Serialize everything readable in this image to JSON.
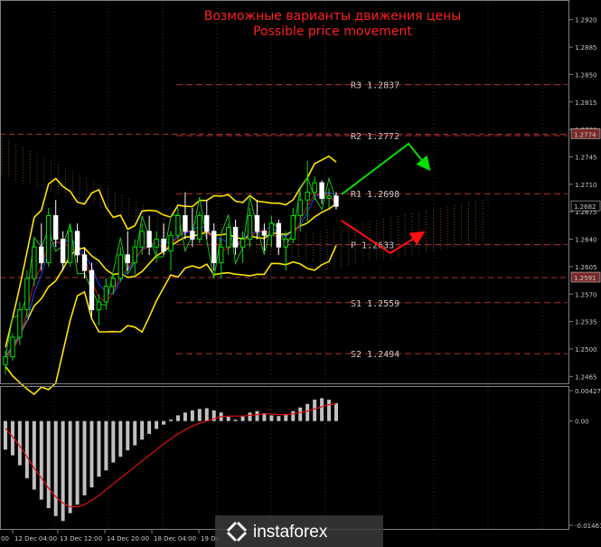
{
  "chart_data": {
    "type": "candlestick",
    "title_ru": "Возможные варианты движения цены",
    "title_en": "Possible price movement",
    "brand": "instaforex",
    "price_ticks": [
      "1.2920",
      "1.2885",
      "1.2850",
      "1.2815",
      "1.2780",
      "1.2745",
      "1.2710",
      "1.2675",
      "1.2640",
      "1.2605",
      "1.2570",
      "1.2535",
      "1.2500",
      "1.2465"
    ],
    "price_tick_values": [
      1.292,
      1.2885,
      1.285,
      1.2815,
      1.278,
      1.2745,
      1.271,
      1.2675,
      1.264,
      1.2605,
      1.257,
      1.2535,
      1.25,
      1.2465
    ],
    "price_range": [
      1.2455,
      1.2945
    ],
    "time_labels": [
      "12 Dec 04:00",
      "13 Dec 12:00",
      "14 Dec 20:00",
      "18 Dec 04:00",
      "19 De"
    ],
    "first_time_label": "00",
    "levels": [
      {
        "name": "R3",
        "text": "R3 1.2837",
        "value": 1.2837
      },
      {
        "name": "R2",
        "text": "R2 1.2772",
        "value": 1.2772
      },
      {
        "name": "R1",
        "text": "R1 1.2698",
        "value": 1.2698
      },
      {
        "name": "P",
        "text": "P 1.2633",
        "value": 1.2633
      },
      {
        "name": "S1",
        "text": "S1 1.2559",
        "value": 1.2559
      },
      {
        "name": "S2",
        "text": "S2 1.2494",
        "value": 1.2494
      }
    ],
    "price_tags": [
      {
        "text": "1.2774",
        "value": 1.2774,
        "bg": "#7a2a2a"
      },
      {
        "text": "1.2682",
        "value": 1.2682,
        "bg": "#000000"
      },
      {
        "text": "1.2591",
        "value": 1.2591,
        "bg": "#7a2a2a"
      }
    ],
    "candles": [
      [
        1.248,
        1.2498,
        1.2468,
        1.249
      ],
      [
        1.249,
        1.252,
        1.2485,
        1.2515
      ],
      [
        1.2515,
        1.256,
        1.2505,
        1.255
      ],
      [
        1.255,
        1.26,
        1.254,
        1.259
      ],
      [
        1.259,
        1.264,
        1.258,
        1.263
      ],
      [
        1.263,
        1.266,
        1.26,
        1.261
      ],
      [
        1.261,
        1.268,
        1.2605,
        1.267
      ],
      [
        1.267,
        1.269,
        1.263,
        1.264
      ],
      [
        1.264,
        1.265,
        1.26,
        1.261
      ],
      [
        1.261,
        1.266,
        1.2605,
        1.265
      ],
      [
        1.265,
        1.266,
        1.261,
        1.262
      ],
      [
        1.262,
        1.263,
        1.259,
        1.26
      ],
      [
        1.26,
        1.261,
        1.254,
        1.255
      ],
      [
        1.255,
        1.257,
        1.253,
        1.256
      ],
      [
        1.256,
        1.259,
        1.255,
        1.258
      ],
      [
        1.258,
        1.2595,
        1.257,
        1.259
      ],
      [
        1.259,
        1.263,
        1.2585,
        1.262
      ],
      [
        1.262,
        1.265,
        1.26,
        1.261
      ],
      [
        1.261,
        1.264,
        1.2595,
        1.263
      ],
      [
        1.263,
        1.266,
        1.262,
        1.265
      ],
      [
        1.265,
        1.267,
        1.262,
        1.263
      ],
      [
        1.263,
        1.265,
        1.261,
        1.264
      ],
      [
        1.264,
        1.266,
        1.262,
        1.2625
      ],
      [
        1.2625,
        1.265,
        1.26,
        1.2645
      ],
      [
        1.2645,
        1.268,
        1.264,
        1.267
      ],
      [
        1.267,
        1.27,
        1.264,
        1.265
      ],
      [
        1.265,
        1.268,
        1.263,
        1.264
      ],
      [
        1.264,
        1.2675,
        1.2635,
        1.267
      ],
      [
        1.267,
        1.269,
        1.264,
        1.265
      ],
      [
        1.265,
        1.266,
        1.26,
        1.261
      ],
      [
        1.261,
        1.264,
        1.259,
        1.263
      ],
      [
        1.263,
        1.266,
        1.262,
        1.2655
      ],
      [
        1.2655,
        1.2665,
        1.262,
        1.263
      ],
      [
        1.263,
        1.265,
        1.261,
        1.264
      ],
      [
        1.264,
        1.268,
        1.263,
        1.267
      ],
      [
        1.267,
        1.269,
        1.264,
        1.265
      ],
      [
        1.265,
        1.266,
        1.2625,
        1.2645
      ],
      [
        1.2645,
        1.267,
        1.263,
        1.266
      ],
      [
        1.266,
        1.2665,
        1.262,
        1.263
      ],
      [
        1.263,
        1.265,
        1.26,
        1.264
      ],
      [
        1.264,
        1.268,
        1.2635,
        1.267
      ],
      [
        1.267,
        1.27,
        1.265,
        1.269
      ],
      [
        1.269,
        1.274,
        1.266,
        1.27
      ],
      [
        1.27,
        1.272,
        1.269,
        1.2712
      ],
      [
        1.2712,
        1.2715,
        1.2685,
        1.2692
      ],
      [
        1.2692,
        1.2705,
        1.268,
        1.2695
      ],
      [
        1.2695,
        1.27,
        1.2678,
        1.2682
      ]
    ],
    "macd_range": [
      -0.0146,
      0.00427
    ],
    "macd_ticks": [
      {
        "text": "0.00427",
        "value": 0.00427
      },
      {
        "text": "0.00",
        "value": 0.0
      },
      {
        "text": "-0.01461",
        "value": -0.0146
      }
    ],
    "macd_hist": [
      -0.004,
      -0.0048,
      -0.0062,
      -0.008,
      -0.0096,
      -0.011,
      -0.0122,
      -0.0133,
      -0.014,
      -0.0129,
      -0.0117,
      -0.0104,
      -0.0093,
      -0.0078,
      -0.0069,
      -0.0058,
      -0.005,
      -0.0041,
      -0.0034,
      -0.0026,
      -0.0018,
      -0.0011,
      -0.0005,
      0.0002,
      0.0008,
      0.0012,
      0.0015,
      0.0017,
      0.0018,
      0.0015,
      0.0012,
      0.0006,
      0.0002,
      0.0007,
      0.0012,
      0.0014,
      0.0011,
      0.0008,
      0.0007,
      0.001,
      0.0014,
      0.0019,
      0.0024,
      0.003,
      0.0032,
      0.003,
      0.0025
    ],
    "macd_signal": [
      -0.001,
      -0.0022,
      -0.0035,
      -0.005,
      -0.0066,
      -0.008,
      -0.0094,
      -0.0106,
      -0.0115,
      -0.012,
      -0.012,
      -0.0117,
      -0.0111,
      -0.0104,
      -0.0096,
      -0.0088,
      -0.008,
      -0.0072,
      -0.0064,
      -0.0056,
      -0.0048,
      -0.004,
      -0.0032,
      -0.0025,
      -0.0018,
      -0.0012,
      -0.0007,
      -0.0003,
      0.0,
      0.0003,
      0.0006,
      0.0007,
      0.0007,
      0.0007,
      0.0008,
      0.0009,
      0.001,
      0.001,
      0.0009,
      0.0009,
      0.001,
      0.0012,
      0.0014,
      0.0017,
      0.002,
      0.0023,
      0.0024
    ],
    "colors": {
      "bull": "#00e000",
      "bear": "#ffffff",
      "bollinger": "#ffe400",
      "level": "#b03030",
      "forecast_up": "#00e000",
      "forecast_down": "#ff1010",
      "cloud": "#c08040",
      "title": "#ff2020"
    }
  }
}
